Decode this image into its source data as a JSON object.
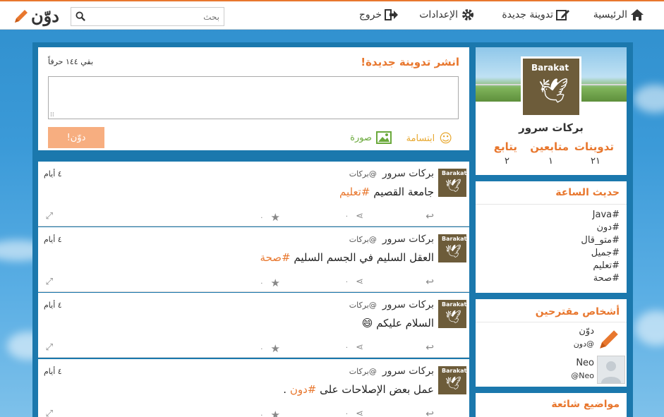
{
  "header": {
    "nav": {
      "home": "الرئيسية",
      "new_post": "تدوينة جديدة",
      "settings": "الإعدادات",
      "logout": "خروج"
    },
    "search_placeholder": "بحث",
    "logo_text": "دوّن"
  },
  "compose": {
    "title": "انشر تدوينة جديدة!",
    "chars_left": "بقي ١٤٤ حرفاً",
    "smile_label": "ابتسامة",
    "image_label": "صورة",
    "post_button": "دوّن!"
  },
  "profile": {
    "avatar_text": "Barakat",
    "name": "بركات سرور",
    "stats": [
      {
        "label": "تدوينات",
        "value": "٢١"
      },
      {
        "label": "متابعين",
        "value": "١"
      },
      {
        "label": "يتابع",
        "value": "٢"
      }
    ]
  },
  "trending": {
    "title": "حديث الساعة",
    "tags": [
      "Java#",
      "#دون",
      "#متو_قال",
      "#جميل",
      "#تعليم",
      "#صحة"
    ]
  },
  "suggested": {
    "title": "أشخاص مقترحين",
    "people": [
      {
        "name": "دوّن",
        "handle": "@دون"
      },
      {
        "name": "Neo",
        "handle": "Neo@"
      }
    ]
  },
  "popular": {
    "title": "مواضيع شائعة"
  },
  "posts": [
    {
      "name": "بركات سرور",
      "handle": "@بركات",
      "time": "٤ أيام",
      "text": "جامعة القصيم",
      "tag": "#تعليم",
      "tail": "",
      "likes": "٠",
      "reposts": "٠"
    },
    {
      "name": "بركات سرور",
      "handle": "@بركات",
      "time": "٤ أيام",
      "text": "العقل السليم في الجسم السليم",
      "tag": "#صحة",
      "tail": "",
      "likes": "٠",
      "reposts": "٠"
    },
    {
      "name": "بركات سرور",
      "handle": "@بركات",
      "time": "٤ أيام",
      "text": "السلام عليكم",
      "tag": "",
      "tail": "😄",
      "likes": "٠",
      "reposts": "٠"
    },
    {
      "name": "بركات سرور",
      "handle": "@بركات",
      "time": "٤ أيام",
      "text": "عمل بعض الإصلاحات على",
      "tag": "#دون",
      "tail": ".",
      "likes": "٠",
      "reposts": "٠"
    }
  ],
  "colors": {
    "accent": "#e8772e",
    "background": "#2f8fcd",
    "container": "#1b78ad"
  }
}
